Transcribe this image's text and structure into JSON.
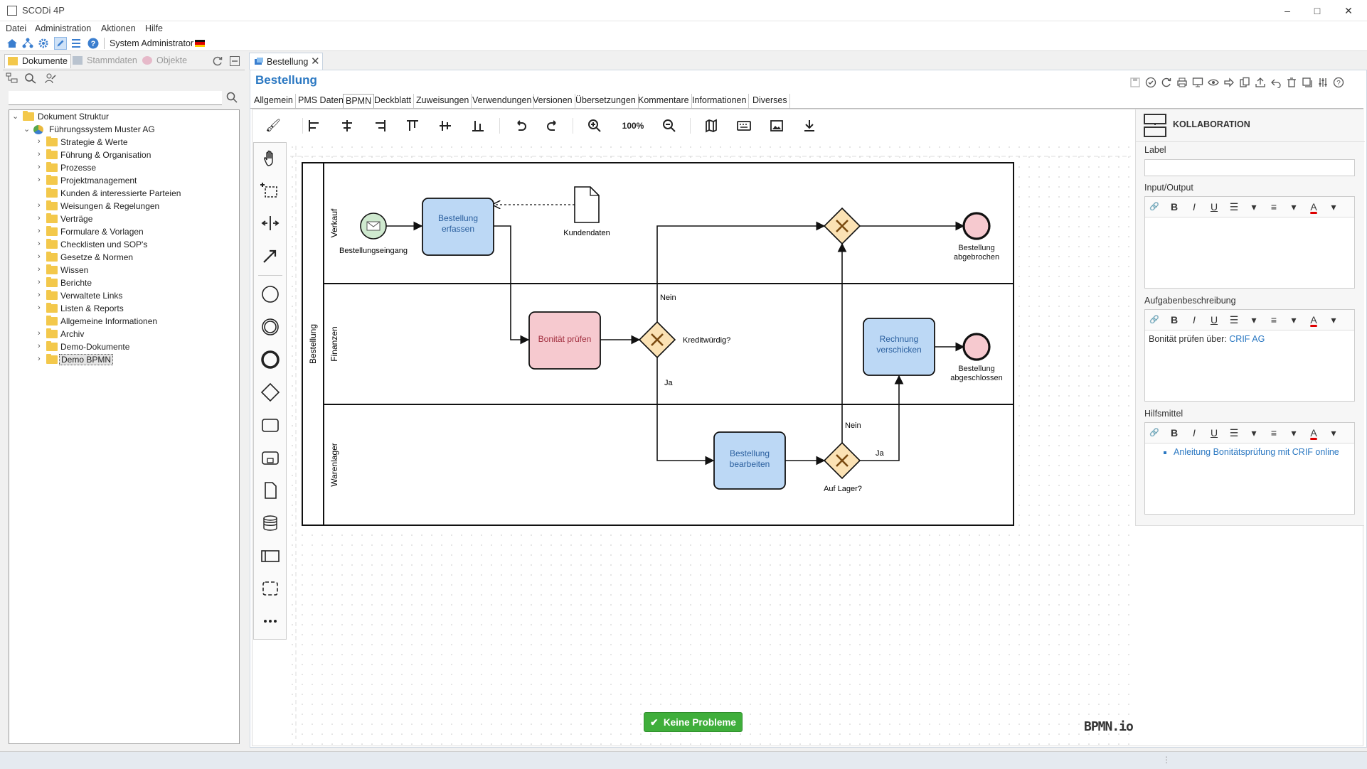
{
  "window": {
    "title": "SCODi 4P",
    "minimize": "–",
    "maximize": "□",
    "close": "✕"
  },
  "menu": [
    "Datei",
    "Administration",
    "Aktionen",
    "Hilfe"
  ],
  "user": {
    "name": "System Administrator"
  },
  "left_tabs": [
    {
      "label": "Dokumente",
      "icon": "folder-icon"
    },
    {
      "label": "Stammdaten",
      "icon": "database-icon"
    },
    {
      "label": "Objekte",
      "icon": "objects-icon"
    }
  ],
  "tree": {
    "root": "Dokument Struktur",
    "system": "Führungssystem Muster AG",
    "items": [
      "Strategie & Werte",
      "Führung & Organisation",
      "Prozesse",
      "Projektmanagement",
      "Kunden & interessierte Parteien",
      "Weisungen & Regelungen",
      "Verträge",
      "Formulare & Vorlagen",
      "Checklisten und SOP's",
      "Gesetze & Normen",
      "Wissen",
      "Berichte",
      "Verwaltete Links",
      "Listen & Reports",
      "Allgemeine Informationen",
      "Archiv",
      "Demo-Dokumente",
      "Demo BPMN"
    ]
  },
  "document": {
    "tab_label": "Bestellung",
    "title": "Bestellung",
    "tabs": [
      "Allgemein",
      "PMS Daten",
      "BPMN",
      "Deckblatt",
      "Zuweisungen",
      "Verwendungen",
      "Versionen",
      "Übersetzungen",
      "Kommentare",
      "Informationen",
      "Diverses"
    ],
    "active_tab": "BPMN"
  },
  "toolbar": {
    "zoom": "100%"
  },
  "diagram": {
    "pool": "Bestellung",
    "lanes": [
      "Verkauf",
      "Finanzen",
      "Warenlager"
    ],
    "start_event": "Bestellungseingang",
    "tasks": {
      "erfassen": "Bestellung erfassen",
      "bonitaet": "Bonität prüfen",
      "rechnung": "Rechnung verschicken",
      "bearbeiten": "Bestellung bearbeiten"
    },
    "data_object": "Kundendaten",
    "gateways": {
      "kredit": "Kreditwürdig?",
      "lager": "Auf Lager?"
    },
    "flow_labels": {
      "nein1": "Nein",
      "ja1": "Ja",
      "nein2": "Nein",
      "ja2": "Ja"
    },
    "end_events": {
      "abgebrochen": "Bestellung abgebrochen",
      "abgeschlossen": "Bestellung abgeschlossen"
    }
  },
  "properties": {
    "header": "KOLLABORATION",
    "label_field": "Label",
    "label_value": "",
    "input_output": "Input/Output",
    "aufgaben": "Aufgabenbeschreibung",
    "aufgaben_text": "Bonität prüfen über: ",
    "aufgaben_link": "CRIF AG",
    "hilfsmittel": "Hilfsmittel",
    "hilfsmittel_link": "Anleitung Bonitätsprüfung mit CRIF online"
  },
  "status": {
    "ok_button": "Keine Probleme",
    "logo": "BPMN.io"
  },
  "colors": {
    "accent": "#2b78c2",
    "task_blue": "#bcd8f5",
    "task_red": "#f6c9cf",
    "gateway": "#fbe2b4",
    "end_event": "#f6c9cf",
    "start_event": "#cfe9cf",
    "ok_green": "#3fae3b"
  }
}
